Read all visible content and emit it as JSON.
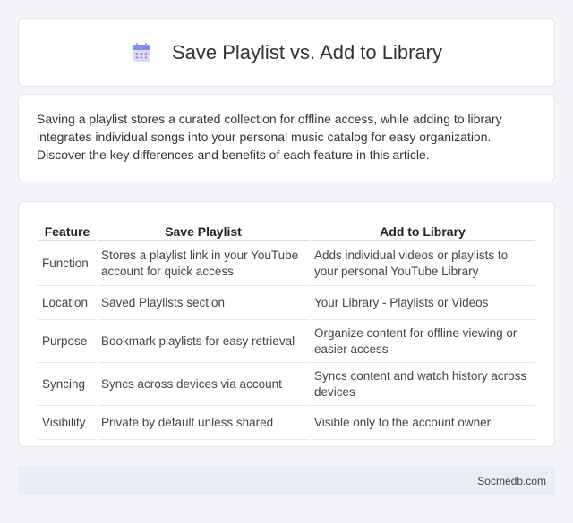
{
  "header": {
    "title": "Save Playlist vs. Add to Library",
    "icon": "calendar-icon"
  },
  "intro": {
    "text": "Saving a playlist stores a curated collection for offline access, while adding to library integrates individual songs into your personal music catalog for easy organization. Discover the key differences and benefits of each feature in this article."
  },
  "table": {
    "headers": [
      "Feature",
      "Save Playlist",
      "Add to Library"
    ],
    "rows": [
      [
        "Function",
        "Stores a playlist link in your YouTube account for quick access",
        "Adds individual videos or playlists to your personal YouTube Library"
      ],
      [
        "Location",
        "Saved Playlists section",
        "Your Library - Playlists or Videos"
      ],
      [
        "Purpose",
        "Bookmark playlists for easy retrieval",
        "Organize content for offline viewing or easier access"
      ],
      [
        "Syncing",
        "Syncs across devices via account",
        "Syncs content and watch history across devices"
      ],
      [
        "Visibility",
        "Private by default unless shared",
        "Visible only to the account owner"
      ]
    ]
  },
  "footer": {
    "text": "Socmedb.com"
  },
  "colors": {
    "accent": "#8a7be0",
    "background": "#f3f5f9",
    "footer_bg": "#e9eef6"
  }
}
